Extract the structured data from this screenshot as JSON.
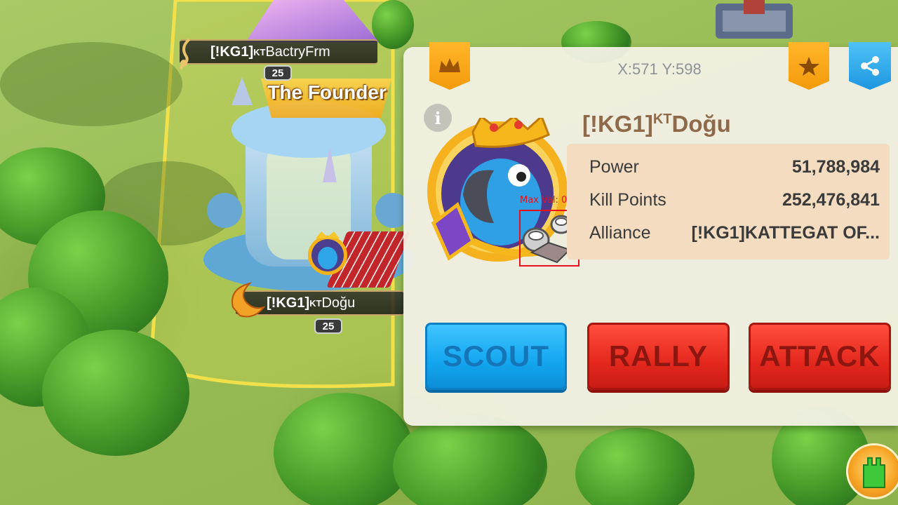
{
  "map": {
    "tags": [
      {
        "alliance": "[!KG1]",
        "kt": "KT",
        "name": "BactryFrm",
        "level": "25"
      },
      {
        "alliance": "[!KG1]",
        "kt": "KT",
        "name": "Doğu",
        "level": "25"
      }
    ],
    "banner": "The Founder"
  },
  "panel": {
    "coords": "X:571 Y:598",
    "icons": {
      "crown": "crown-icon",
      "star": "star-icon",
      "share": "share-icon",
      "info": "info-icon"
    },
    "player": {
      "alliance_tag": "[!KG1]",
      "kt": "KT",
      "name": "Doğu"
    },
    "stats": [
      {
        "label": "Power",
        "value": "51,788,984"
      },
      {
        "label": "Kill Points",
        "value": "252,476,841"
      },
      {
        "label": "Alliance",
        "value": "[!KG1]KATTEGAT OF..."
      }
    ],
    "detection": {
      "label": "Max Val: 0.93",
      "color": "#e8101a"
    },
    "buttons": {
      "scout": "SCOUT",
      "rally": "RALLY",
      "attack": "ATTACK"
    }
  },
  "colors": {
    "scout": "#13a6ef",
    "rally": "#e4281e",
    "attack": "#e4281e",
    "ribbon_gold": "#f7a50e",
    "ribbon_blue": "#1e96e0"
  }
}
